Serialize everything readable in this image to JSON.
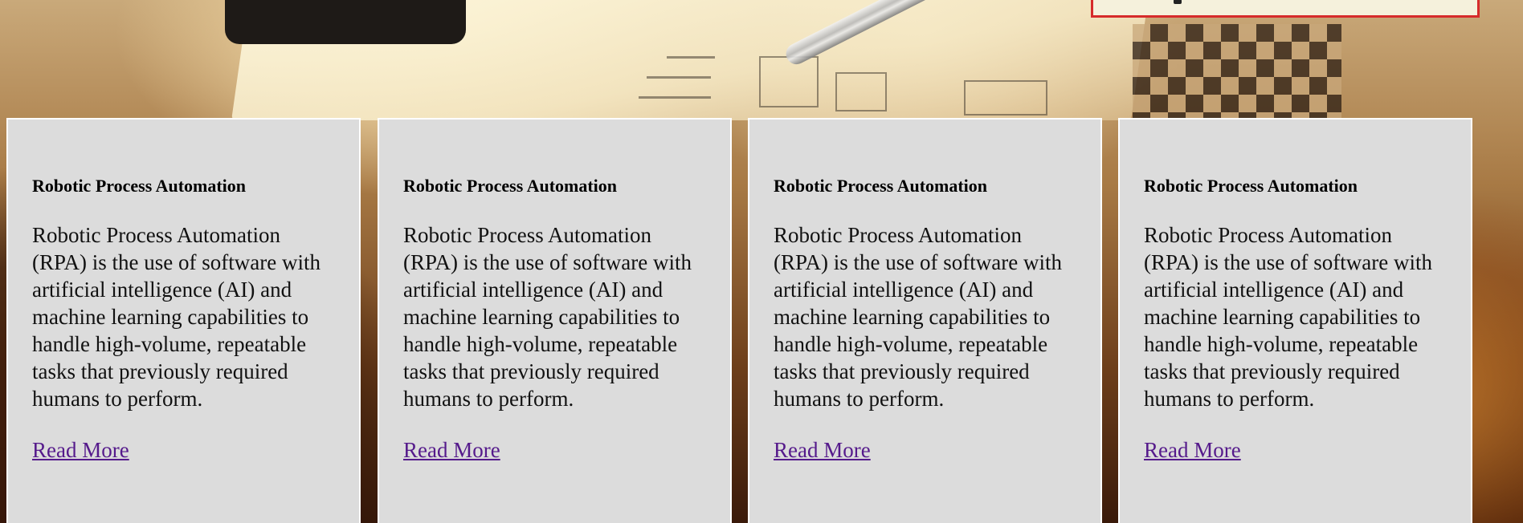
{
  "cards": [
    {
      "title": "Robotic Process Automation",
      "text": "Robotic Process Automation (RPA) is the use of software with artificial intelligence (AI) and machine learning capabilities to handle high-volume, repeatable tasks that previously required humans to perform.",
      "link_label": "Read More"
    },
    {
      "title": "Robotic Process Automation",
      "text": "Robotic Process Automation (RPA) is the use of software with artificial intelligence (AI) and machine learning capabilities to handle high-volume, repeatable tasks that previously required humans to perform.",
      "link_label": "Read More"
    },
    {
      "title": "Robotic Process Automation",
      "text": "Robotic Process Automation (RPA) is the use of software with artificial intelligence (AI) and machine learning capabilities to handle high-volume, repeatable tasks that previously required humans to perform.",
      "link_label": "Read More"
    },
    {
      "title": "Robotic Process Automation",
      "text": "Robotic Process Automation (RPA) is the use of software with artificial intelligence (AI) and machine learning capabilities to handle high-volume, repeatable tasks that previously required humans to perform.",
      "link_label": "Read More"
    }
  ],
  "colors": {
    "card_background": "#dcdcdc",
    "card_border": "#ffffff",
    "link": "#551a8b",
    "notice_border": "#d62b2b",
    "notice_background": "#f5f1dc"
  }
}
